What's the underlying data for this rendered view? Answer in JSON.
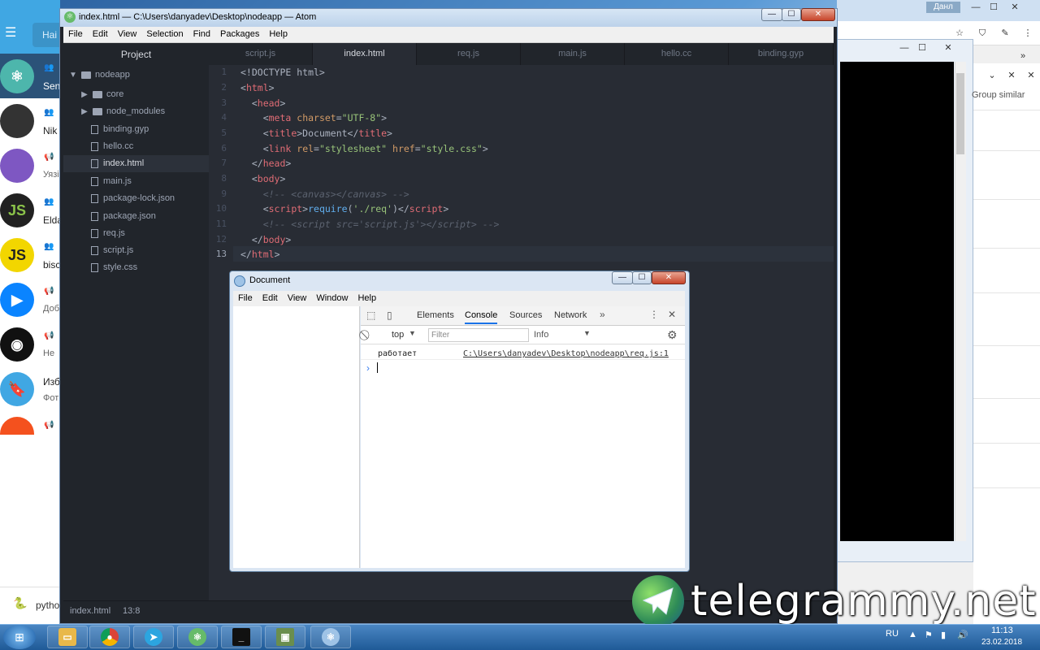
{
  "telegram": {
    "search_placeholder": "Наi",
    "chats": [
      {
        "name": "Sen",
        "avatar_color": "#4db6ac"
      },
      {
        "name": "Nik",
        "sub": "",
        "avatar_color": "#333333"
      },
      {
        "name": "",
        "sub": "Уязі",
        "avatar_color": "#7e57c2"
      },
      {
        "name": "Elda",
        "sub": "",
        "avatar_color": "#212121",
        "avatar_text": "JS"
      },
      {
        "name": "bisc",
        "sub": "",
        "avatar_color": "#f2d600",
        "avatar_text": "JS"
      },
      {
        "name": "",
        "sub": "Доб",
        "avatar_color": "#0a84ff"
      },
      {
        "name": "",
        "sub": "Не",
        "avatar_color": "#111111"
      },
      {
        "name": "Изб",
        "sub": "Фот",
        "avatar_color": "#40a7e3"
      }
    ],
    "bottom_label": "pytho"
  },
  "background_window": {
    "user_badge": "Данл",
    "group_similar": "Group similar"
  },
  "atom": {
    "title": "index.html — C:\\Users\\danyadev\\Desktop\\nodeapp — Atom",
    "menu": [
      "File",
      "Edit",
      "View",
      "Selection",
      "Find",
      "Packages",
      "Help"
    ],
    "tree_header": "Project",
    "tree": {
      "root": "nodeapp",
      "folders": [
        "core",
        "node_modules"
      ],
      "files": [
        "binding.gyp",
        "hello.cc",
        "index.html",
        "main.js",
        "package-lock.json",
        "package.json",
        "req.js",
        "script.js",
        "style.css"
      ],
      "selected": "index.html"
    },
    "tabs": [
      "script.js",
      "index.html",
      "req.js",
      "main.js",
      "hello.cc",
      "binding.gyp"
    ],
    "active_tab": "index.html",
    "line_numbers": [
      "1",
      "2",
      "3",
      "4",
      "5",
      "6",
      "7",
      "8",
      "9",
      "10",
      "11",
      "12",
      "13"
    ],
    "status_file": "index.html",
    "status_pos": "13:8"
  },
  "document_window": {
    "title": "Document",
    "menu": [
      "File",
      "Edit",
      "View",
      "Window",
      "Help"
    ],
    "devtools": {
      "tabs": [
        "Elements",
        "Console",
        "Sources",
        "Network"
      ],
      "active_tab": "Console",
      "context": "top",
      "filter_placeholder": "Filter",
      "level": "Info",
      "log_message": "работает",
      "log_source": "C:\\Users\\danyadev\\Desktop\\nodeapp\\req.js:1"
    }
  },
  "watermark": {
    "text": "telegrammy.net"
  },
  "taskbar": {
    "lang": "RU",
    "time": "11:13",
    "date": "23.02.2018"
  },
  "colors": {
    "editor_bg": "#282c34",
    "tree_bg": "#21252b",
    "tag": "#e06c75",
    "attr": "#d19a66",
    "string": "#98c379",
    "comment": "#5c6370"
  }
}
